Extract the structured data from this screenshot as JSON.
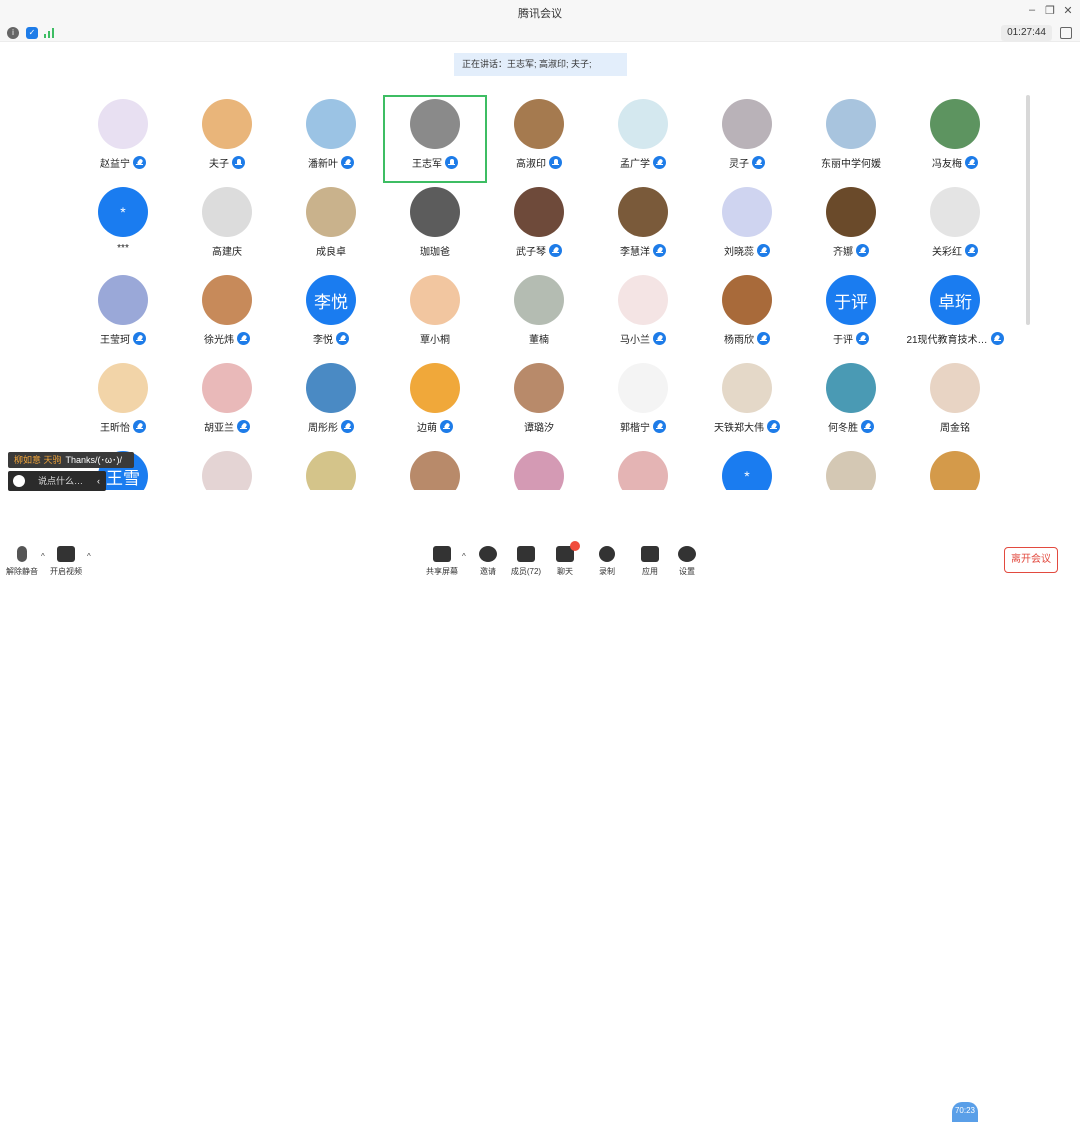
{
  "window": {
    "title": "腾讯会议"
  },
  "status": {
    "timer": "01:27:44"
  },
  "speaking": {
    "text": "正在讲话：王志军; 高淑印; 夫子;"
  },
  "participants": [
    {
      "name": "赵益宁",
      "bg": "#e8e0f2",
      "mic": "muted"
    },
    {
      "name": "夫子",
      "bg": "#e9b57a",
      "mic": "on"
    },
    {
      "name": "潘新叶",
      "bg": "#9bc3e4",
      "mic": "muted"
    },
    {
      "name": "王志军",
      "bg": "#8a8a8a",
      "mic": "on",
      "active": true
    },
    {
      "name": "高淑印",
      "bg": "#a57a4f",
      "mic": "on"
    },
    {
      "name": "孟广学",
      "bg": "#d4e8ef",
      "mic": "muted"
    },
    {
      "name": "灵子",
      "bg": "#b9b2b8",
      "mic": "muted"
    },
    {
      "name": "东丽中学何媛",
      "bg": "#a8c4de",
      "mic": "none"
    },
    {
      "name": "冯友梅",
      "bg": "#5d9460",
      "mic": "muted"
    },
    {
      "name": "***",
      "bg": "#1a7cf0",
      "mic": "none",
      "glyph": "*"
    },
    {
      "name": "高建庆",
      "bg": "#dcdcdc",
      "mic": "none"
    },
    {
      "name": "成良卓",
      "bg": "#c9b28c",
      "mic": "none"
    },
    {
      "name": "珈珈爸",
      "bg": "#5c5c5c",
      "mic": "none"
    },
    {
      "name": "武子琴",
      "bg": "#6e4a3a",
      "mic": "muted"
    },
    {
      "name": "李慧洋",
      "bg": "#7a5a3a",
      "mic": "muted"
    },
    {
      "name": "刘晓蕊",
      "bg": "#cfd4f0",
      "mic": "muted"
    },
    {
      "name": "齐娜",
      "bg": "#6a4a2a",
      "mic": "muted"
    },
    {
      "name": "关彩红",
      "bg": "#e4e4e4",
      "mic": "muted"
    },
    {
      "name": "王莹珂",
      "bg": "#9aa8d8",
      "mic": "muted"
    },
    {
      "name": "徐光炜",
      "bg": "#c78a5a",
      "mic": "muted"
    },
    {
      "name": "李悦",
      "bg": "#1a7cf0",
      "mic": "muted",
      "glyph": "李悦"
    },
    {
      "name": "覃小桐",
      "bg": "#f2c6a0",
      "mic": "none"
    },
    {
      "name": "董楠",
      "bg": "#b4bcb2",
      "mic": "none"
    },
    {
      "name": "马小兰",
      "bg": "#f4e4e4",
      "mic": "muted"
    },
    {
      "name": "杨雨欣",
      "bg": "#a86a3a",
      "mic": "muted"
    },
    {
      "name": "于评",
      "bg": "#1a7cf0",
      "mic": "muted",
      "glyph": "于评"
    },
    {
      "name": "21现代教育技术…",
      "bg": "#1a7cf0",
      "mic": "muted",
      "glyph": "卓珩"
    },
    {
      "name": "王昕怡",
      "bg": "#f2d4a8",
      "mic": "muted"
    },
    {
      "name": "胡亚兰",
      "bg": "#e9b9b9",
      "mic": "muted"
    },
    {
      "name": "周彤彤",
      "bg": "#4a8ac4",
      "mic": "muted"
    },
    {
      "name": "边萌",
      "bg": "#f0a83a",
      "mic": "muted"
    },
    {
      "name": "谭璐汐",
      "bg": "#b88a6a",
      "mic": "none"
    },
    {
      "name": "郭楷宁",
      "bg": "#f4f4f4",
      "mic": "muted"
    },
    {
      "name": "天铁郑大伟",
      "bg": "#e4d8c8",
      "mic": "muted"
    },
    {
      "name": "何冬胜",
      "bg": "#4a9ab4",
      "mic": "muted"
    },
    {
      "name": "周金铭",
      "bg": "#e8d4c4",
      "mic": "none"
    },
    {
      "name": "",
      "bg": "#1a7cf0",
      "mic": "none",
      "glyph": "王雪"
    },
    {
      "name": "",
      "bg": "#e4d4d4",
      "mic": "none"
    },
    {
      "name": "",
      "bg": "#d4c48a",
      "mic": "none"
    },
    {
      "name": "",
      "bg": "#b88a6a",
      "mic": "none"
    },
    {
      "name": "",
      "bg": "#d49ab4",
      "mic": "none"
    },
    {
      "name": "",
      "bg": "#e4b4b4",
      "mic": "none"
    },
    {
      "name": "",
      "bg": "#1a7cf0",
      "mic": "none",
      "glyph": "*"
    },
    {
      "name": "",
      "bg": "#d4c8b4",
      "mic": "none"
    },
    {
      "name": "",
      "bg": "#d49a4a",
      "mic": "none"
    }
  ],
  "chat": {
    "sender": "柳如意 天驹",
    "message": "Thanks/(･ω･)/",
    "placeholder": "说点什么…"
  },
  "toolbar": {
    "unmute": "解除静音",
    "video": "开启视频",
    "share": "共享屏幕",
    "invite": "邀请",
    "members": "成员(72)",
    "chat": "聊天",
    "record": "录制",
    "apps": "应用",
    "settings": "设置",
    "leave": "离开会议",
    "clock": "70:23"
  }
}
